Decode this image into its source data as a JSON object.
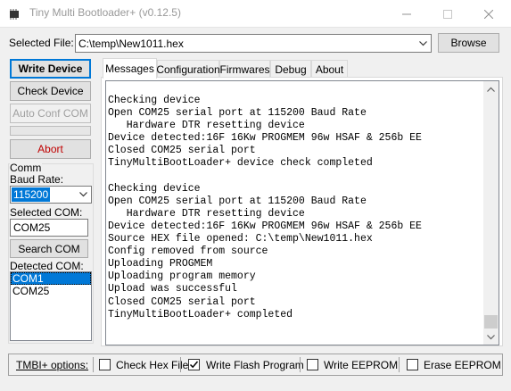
{
  "window": {
    "title": "Tiny Multi Bootloader+ (v0.12.5)",
    "minimize_icon": "minimize-icon",
    "maximize_icon": "maximize-icon",
    "close_icon": "close-icon"
  },
  "file": {
    "label": "Selected File:",
    "value": "C:\\temp\\New1011.hex",
    "browse_label": "Browse"
  },
  "actions": {
    "write_device": "Write Device",
    "check_device": "Check Device",
    "auto_conf_com": "Auto Conf COM",
    "abort": "Abort",
    "progress": 0
  },
  "comm": {
    "group_label": "Comm",
    "baud_label": "Baud Rate:",
    "baud_value": "115200",
    "selected_com_label": "Selected COM:",
    "selected_com_value": "COM25",
    "search_com": "Search COM",
    "detected_com_label": "Detected COM:",
    "detected": [
      "COM1",
      "COM25"
    ],
    "detected_selected": "COM1"
  },
  "tabs": [
    {
      "label": "Messages",
      "active": true
    },
    {
      "label": "Configuration",
      "active": false
    },
    {
      "label": "Firmwares",
      "active": false
    },
    {
      "label": "Debug",
      "active": false
    },
    {
      "label": "About",
      "active": false
    }
  ],
  "messages": [
    "Checking device",
    "Open COM25 serial port at 115200 Baud Rate",
    "   Hardware DTR resetting device",
    "Device detected:16F 16Kw PROGMEM 96w HSAF & 256b EE",
    "Closed COM25 serial port",
    "TinyMultiBootLoader+ device check completed",
    "",
    "Checking device",
    "Open COM25 serial port at 115200 Baud Rate",
    "   Hardware DTR resetting device",
    "Device detected:16F 16Kw PROGMEM 96w HSAF & 256b EE",
    "Source HEX file opened: C:\\temp\\New1011.hex",
    "Config removed from source",
    "Uploading PROGMEM",
    "Uploading program memory",
    "Upload was successful",
    "Closed COM25 serial port",
    "TinyMultiBootLoader+ completed"
  ],
  "options": {
    "label": "TMBI+ options:",
    "check_hex_file": {
      "label": "Check Hex File",
      "checked": false
    },
    "write_flash_program": {
      "label": "Write Flash Program",
      "checked": true
    },
    "write_eeprom": {
      "label": "Write EEPROM",
      "checked": false
    },
    "erase_eeprom": {
      "label": "Erase EEPROM",
      "checked": false
    }
  }
}
